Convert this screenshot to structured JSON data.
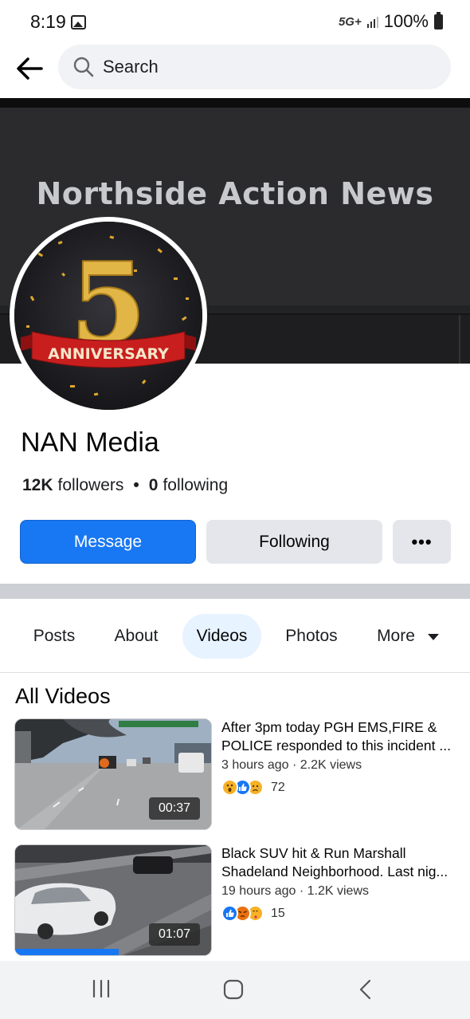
{
  "status_bar": {
    "time": "8:19",
    "network": "5G+",
    "battery": "100%"
  },
  "search": {
    "placeholder": "Search"
  },
  "cover": {
    "title": "Northside Action News"
  },
  "avatar": {
    "number": "5",
    "ribbon": "ANNIVERSARY"
  },
  "profile": {
    "name": "NAN Media",
    "followers_count": "12K",
    "followers_label": "followers",
    "following_count": "0",
    "following_label": "following",
    "dot": "•"
  },
  "actions": {
    "message": "Message",
    "following": "Following",
    "more": "•••"
  },
  "tabs": [
    {
      "label": "Posts"
    },
    {
      "label": "About"
    },
    {
      "label": "Videos",
      "active": true
    },
    {
      "label": "Photos"
    },
    {
      "label": "More"
    }
  ],
  "section_title": "All Videos",
  "videos": [
    {
      "title_line1": "After 3pm today PGH EMS,FIRE &",
      "title_line2": "POLICE responded to this incident ...",
      "meta": "3 hours ago · 2.2K views",
      "reactions": [
        "wow",
        "like",
        "sad"
      ],
      "reaction_count": "72",
      "duration": "00:37",
      "progress": 0
    },
    {
      "title_line1": "Black SUV hit & Run Marshall",
      "title_line2": "Shadeland Neighborhood. Last nig...",
      "meta": "19 hours ago · 1.2K views",
      "reactions": [
        "like",
        "angry",
        "care"
      ],
      "reaction_count": "15",
      "duration": "01:07",
      "progress": 0.53
    }
  ],
  "colors": {
    "brand_blue": "#1877f2",
    "active_tab_bg": "#e7f3ff",
    "button_gray": "#e4e6eb"
  }
}
